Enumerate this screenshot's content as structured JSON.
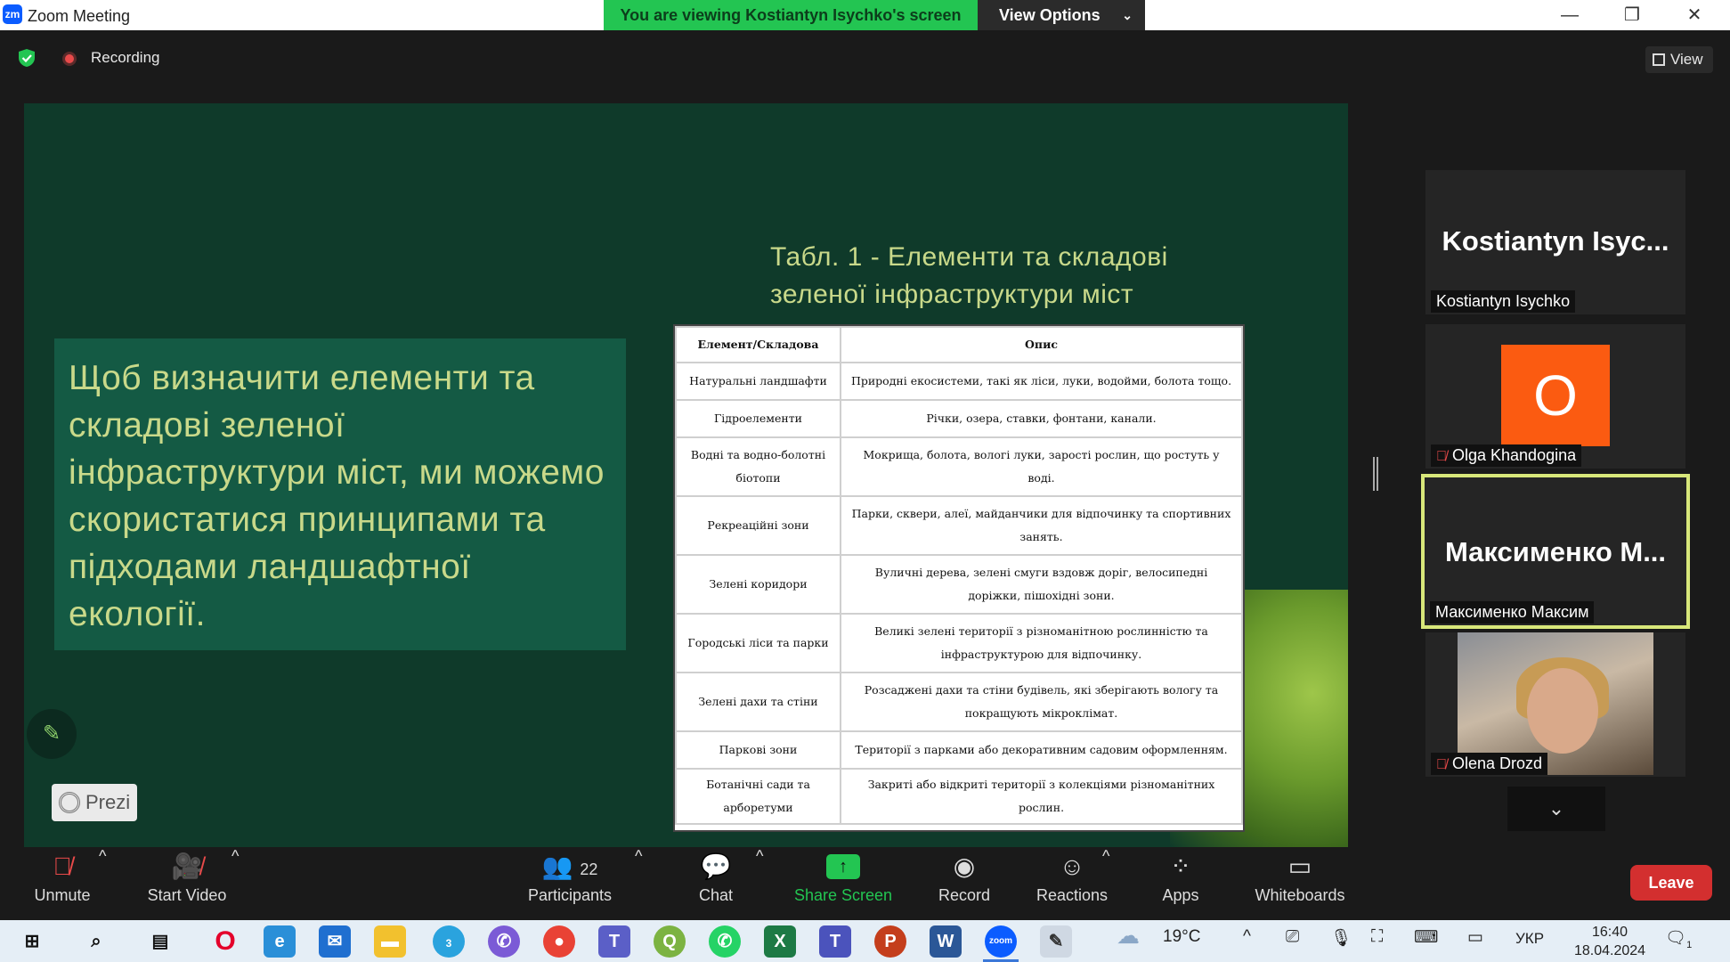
{
  "window": {
    "app_title": "Zoom Meeting",
    "logo_text": "zm"
  },
  "banner": {
    "viewing_text": "You are viewing Kostiantyn Isychko's screen",
    "view_options": "View Options"
  },
  "meeting_bar": {
    "recording_label": "Recording",
    "view_label": "View"
  },
  "slide": {
    "table_title": "Табл. 1 - Елементи та складові зеленої інфраструктури міст",
    "body_text": "Щоб визначити елементи та складові зеленої інфраструктури міст, ми можемо скористатися принципами та підходами ландшафтної екології.",
    "prezi_label": "Prezi",
    "table": {
      "headers": [
        "Елемент/Складова",
        "Опис"
      ],
      "rows": [
        [
          "Натуральні ландшафти",
          "Природні екосистеми, такі як ліси, луки, водойми, болота тощо."
        ],
        [
          "Гідроелементи",
          "Річки, озера, ставки, фонтани, канали."
        ],
        [
          "Водні та водно-болотні біотопи",
          "Мокрища, болота, вологі луки, зарості рослин, що ростуть у воді."
        ],
        [
          "Рекреаційні зони",
          "Парки, сквери, алеї, майданчики для відпочинку та спортивних занять."
        ],
        [
          "Зелені коридори",
          "Вуличні дерева, зелені смуги вздовж доріг, велосипедні доріжки, пішохідні зони."
        ],
        [
          "Городські ліси та парки",
          "Великі зелені території з різноманітною рослинністю та інфраструктурою для відпочинку."
        ],
        [
          "Зелені дахи та стіни",
          "Розсаджені дахи та стіни будівель, які зберігають вологу та покращують мікроклімат."
        ],
        [
          "Паркові зони",
          "Території з парками або декоративним садовим оформленням."
        ],
        [
          "Ботанічні сади та арборетуми",
          "Закриті або відкриті території з колекціями різноманітних рослин."
        ]
      ]
    }
  },
  "participants": [
    {
      "big_name": "Kostiantyn Isyc...",
      "name": "Kostiantyn Isychko"
    },
    {
      "avatar_letter": "O",
      "name": "Olga Khandogina",
      "avatar_color": "#fb5b11"
    },
    {
      "big_name": "Максименко М...",
      "name": "Максименко Максим"
    },
    {
      "name": "Olena Drozd"
    }
  ],
  "toolbar": {
    "unmute": "Unmute",
    "start_video": "Start Video",
    "participants": "Participants",
    "participants_count": "22",
    "chat": "Chat",
    "share_screen": "Share Screen",
    "record": "Record",
    "reactions": "Reactions",
    "apps": "Apps",
    "whiteboards": "Whiteboards",
    "leave": "Leave"
  },
  "taskbar": {
    "weather": "19°C",
    "language": "УКР",
    "time": "16:40",
    "date": "18.04.2024",
    "notification_count": "1",
    "telegram_badge": "3",
    "zoom_label": "zoom"
  },
  "colors": {
    "accent_green": "#23c552",
    "slide_bg": "#0f3a2a",
    "leave_red": "#d32f2f",
    "speaking_border": "#d8e77a"
  }
}
